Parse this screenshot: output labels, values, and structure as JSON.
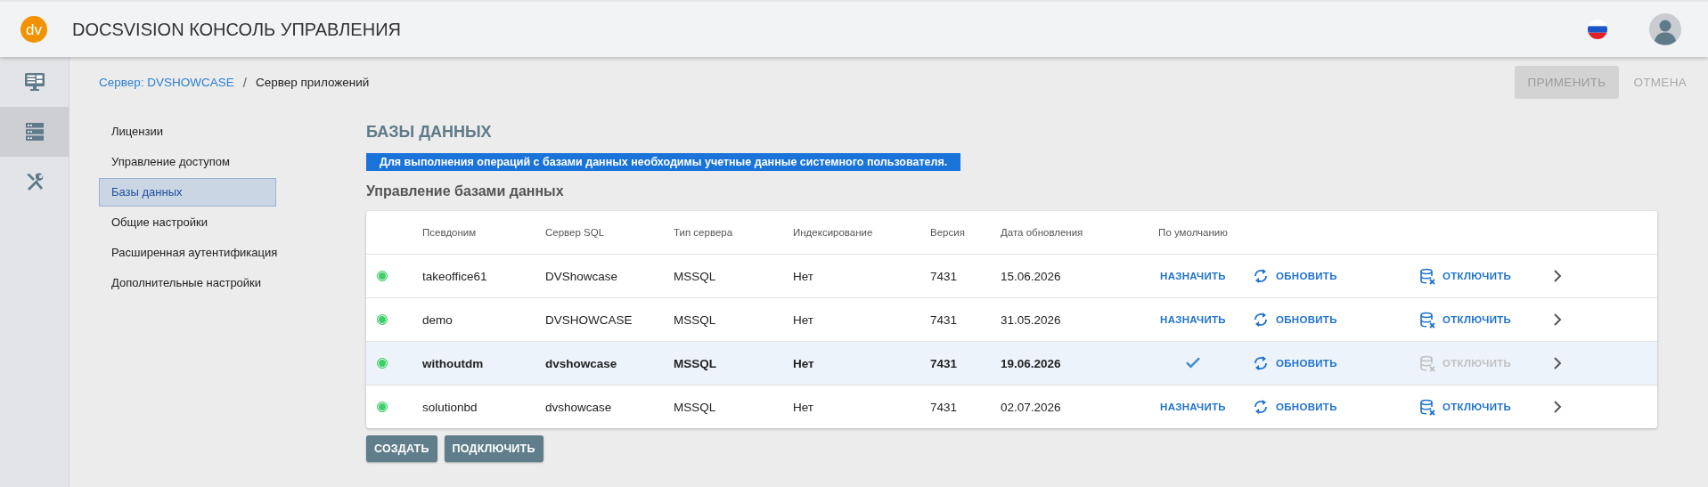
{
  "header": {
    "logo": "dv",
    "title": "DOCSVISION КОНСОЛЬ УПРАВЛЕНИЯ"
  },
  "rail": [
    {
      "kind": "monitor",
      "selected": false
    },
    {
      "kind": "servers",
      "selected": true
    },
    {
      "kind": "tools",
      "selected": false
    }
  ],
  "breadcrumb": {
    "link": "Сервер: DVSHOWCASE",
    "separator": "/",
    "current": "Сервер приложений"
  },
  "actions": {
    "apply": {
      "label": "ПРИМЕНИТЬ",
      "disabled": true
    },
    "cancel": {
      "label": "ОТМЕНА",
      "disabled": true
    }
  },
  "menu": [
    {
      "label": "Лицензии",
      "selected": false
    },
    {
      "label": "Управление доступом",
      "selected": false
    },
    {
      "label": "Базы данных",
      "selected": true
    },
    {
      "label": "Общие настройки",
      "selected": false
    },
    {
      "label": "Расширенная аутентификация",
      "selected": false
    },
    {
      "label": "Дополнительные настройки",
      "selected": false
    }
  ],
  "page_title": "БАЗЫ ДАННЫХ",
  "notice": "Для выполнения операций с базами данных необходимы учетные данные системного пользователя.",
  "section_title": "Управление базами данных",
  "table": {
    "columns": [
      "Псевдоним",
      "Сервер SQL",
      "Тип сервера",
      "Индексирование",
      "Версия",
      "Дата обновления",
      "По умолчанию"
    ],
    "rows": [
      {
        "connected": true,
        "cells": [
          "takeoffice61",
          "DVShowcase",
          "MSSQL",
          "Нет",
          "7431",
          "15.06.2026"
        ],
        "is_default": false,
        "set_default": "НАЗНАЧИТЬ",
        "refresh": "ОБНОВИТЬ",
        "disconnect": "ОТКЛЮЧИТЬ",
        "disconnect_disabled": false
      },
      {
        "connected": true,
        "cells": [
          "demo",
          "DVSHOWCASE",
          "MSSQL",
          "Нет",
          "7431",
          "31.05.2026"
        ],
        "is_default": false,
        "set_default": "НАЗНАЧИТЬ",
        "refresh": "ОБНОВИТЬ",
        "disconnect": "ОТКЛЮЧИТЬ",
        "disconnect_disabled": false
      },
      {
        "connected": true,
        "cells": [
          "withoutdm",
          "dvshowcase",
          "MSSQL",
          "Нет",
          "7431",
          "19.06.2026"
        ],
        "is_default": true,
        "refresh": "ОБНОВИТЬ",
        "disconnect": "ОТКЛЮЧИТЬ",
        "disconnect_disabled": true
      },
      {
        "connected": true,
        "cells": [
          "solutionbd",
          "dvshowcase",
          "MSSQL",
          "Нет",
          "7431",
          "02.07.2026"
        ],
        "is_default": false,
        "set_default": "НАЗНАЧИТЬ",
        "refresh": "ОБНОВИТЬ",
        "disconnect": "ОТКЛЮЧИТЬ",
        "disconnect_disabled": false
      }
    ]
  },
  "buttons": [
    "СОЗДАТЬ",
    "ПОДКЛЮЧИТЬ"
  ]
}
